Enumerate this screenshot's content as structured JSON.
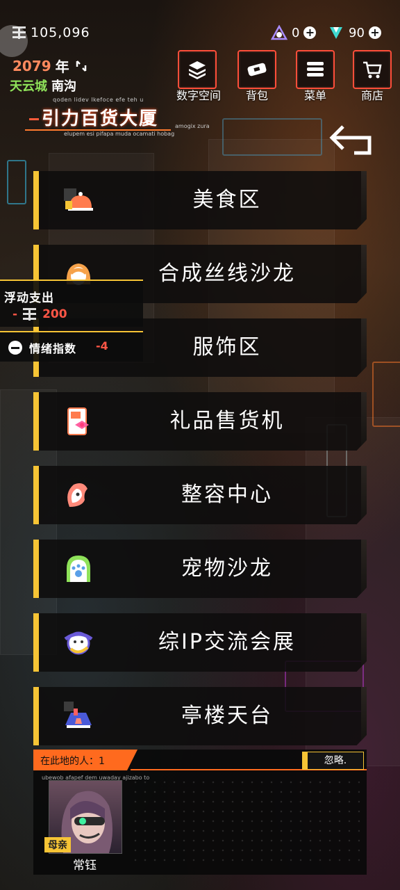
{
  "top": {
    "money": "105,096",
    "resource1": "0",
    "resource2": "90"
  },
  "status": {
    "year": "2079",
    "year_suffix": "年",
    "city": "天云城",
    "district": "南沟"
  },
  "nav": [
    {
      "label": "数字空间"
    },
    {
      "label": "背包"
    },
    {
      "label": "菜单"
    },
    {
      "label": "商店"
    }
  ],
  "location": {
    "title": "引力百货大厦",
    "subtitle_top": "qoden lidev lkefoce efe teh u",
    "subtitle_bottom": "elupem esi pifapa muda ocamati hobag",
    "subtitle_right": "amogix zura"
  },
  "menu": [
    {
      "label": "美食区",
      "icon": "food-dome-icon"
    },
    {
      "label": "合成丝线沙龙",
      "icon": "hair-salon-icon"
    },
    {
      "label": "服饰区",
      "icon": "clothing-icon"
    },
    {
      "label": "礼品售货机",
      "icon": "gift-machine-icon"
    },
    {
      "label": "整容中心",
      "icon": "face-surgery-icon"
    },
    {
      "label": "宠物沙龙",
      "icon": "pet-salon-icon"
    },
    {
      "label": "综IP交流会展",
      "icon": "ip-expo-icon"
    },
    {
      "label": "亭楼天台",
      "icon": "rooftop-icon"
    }
  ],
  "popups": {
    "expense_title": "浮动支出",
    "expense_sign": "-",
    "expense_value": "200",
    "mood_title": "情绪指数",
    "mood_value": "-4"
  },
  "people": {
    "header": "在此地的人：1",
    "ignore_label": "忽略.",
    "tiny_text": "ubewob afapef dem uwaday ajizabo to",
    "person": {
      "role": "母亲",
      "name": "常钰"
    }
  },
  "colors": {
    "accent_yellow": "#f6c435",
    "accent_orange": "#ff6a1e",
    "nav_border": "#ff4e3a",
    "negative_red": "#ff5646",
    "city_green": "#8fe25a"
  }
}
